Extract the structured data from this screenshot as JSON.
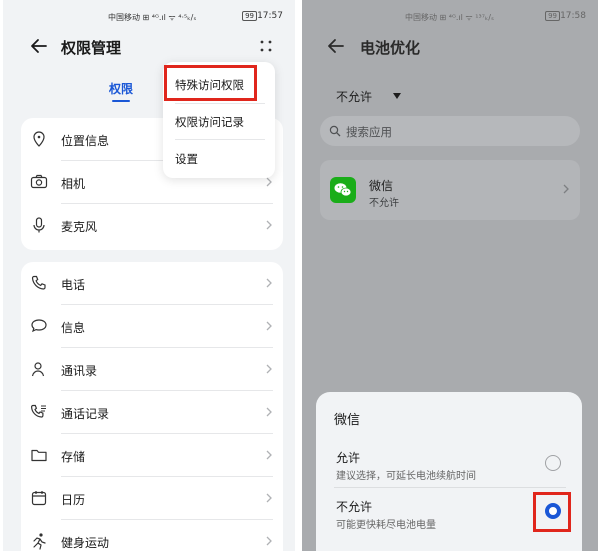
{
  "colors": {
    "accent": "#1a57d6",
    "highlight": "#e0261c",
    "wechat_green": "#1aad19"
  },
  "left": {
    "status": {
      "carrier": "中国移动 ⊞ ⁴ᴳ.ıl ᯤ ⁴·⁵ₖ/ₛ",
      "battery": "99",
      "time": "17:57"
    },
    "title": "权限管理",
    "active_tab": "权限",
    "popup_menu": [
      {
        "label": "特殊访问权限",
        "icon": ""
      },
      {
        "label": "权限访问记录"
      },
      {
        "label": "设置"
      }
    ],
    "permissions_group1": [
      {
        "label": "位置信息",
        "icon": "location-icon"
      },
      {
        "label": "相机",
        "icon": "camera-icon"
      },
      {
        "label": "麦克风",
        "icon": "microphone-icon"
      }
    ],
    "permissions_group2": [
      {
        "label": "电话",
        "icon": "phone-icon"
      },
      {
        "label": "信息",
        "icon": "message-icon"
      },
      {
        "label": "通讯录",
        "icon": "contacts-icon"
      },
      {
        "label": "通话记录",
        "icon": "call-log-icon"
      },
      {
        "label": "存储",
        "icon": "folder-icon"
      },
      {
        "label": "日历",
        "icon": "calendar-icon"
      },
      {
        "label": "健身运动",
        "icon": "fitness-icon"
      }
    ]
  },
  "right": {
    "status": {
      "carrier": "中国移动 ⊞ ⁴ᴳ.ıl ᯤ ¹³⁷ₖ/ₛ",
      "battery": "99",
      "time": "17:58"
    },
    "title": "电池优化",
    "filter": "不允许",
    "search_placeholder": "搜索应用",
    "app": {
      "name": "微信",
      "status": "不允许"
    },
    "sheet": {
      "title": "微信",
      "options": [
        {
          "title": "允许",
          "desc": "建议选择，可延长电池续航时间",
          "selected": false
        },
        {
          "title": "不允许",
          "desc": "可能更快耗尽电池电量",
          "selected": true
        }
      ]
    }
  }
}
